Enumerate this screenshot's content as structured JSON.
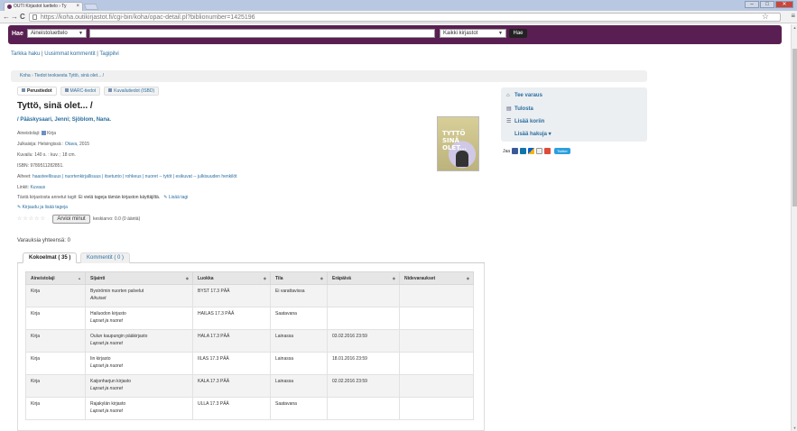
{
  "browser": {
    "tab_title": "OUTI Kirjastot luettelo › Ty",
    "url_host": "https://koha.outikirjastot.fi",
    "url_path": "/cgi-bin/koha/opac-detail.pl?biblionumber=1425196",
    "win_min": "–",
    "win_max": "□",
    "win_close": "✕",
    "back": "←",
    "forward": "→",
    "reload": "C",
    "star": "☆",
    "menu": "≡"
  },
  "search": {
    "label": "Hae",
    "type_select": "Aineistoluettelo",
    "query": "",
    "library_select": "Kaikki kirjastot",
    "button": "Hae"
  },
  "toplinks": [
    "Tarkka haku",
    "Uusimmat kommentit",
    "Tagipilvi"
  ],
  "breadcrumb": [
    "Koha",
    "Tiedot teoksesta Tyttö, sinä olet... /"
  ],
  "view_tabs": [
    "Perustiedot",
    "MARC-tiedot",
    "Kuvailutiedot (ISBD)"
  ],
  "record": {
    "title": "Tyttö, sinä olet... /",
    "authors": "/ Pääskysaari, Jenni; Sjöblom, Nana.",
    "material_label": "Aineistolaji:",
    "material_value": "Kirja",
    "publisher_label": "Julkaisija:",
    "publisher_pre": "Helsingissä :",
    "publisher_link": "Otava,",
    "publisher_year": "2015",
    "description_label": "Kuvailu:",
    "description_value": "140 s. : kuv. ; 18 cm.",
    "isbn_label": "ISBN:",
    "isbn_value": "9789511282851.",
    "subjects_label": "Aiheet:",
    "subjects_value": "haasteellisuus | nuortenkirjallisuus | itsetunto | rohkeus | nuoret -- tytöt | esikuvat -- julkisuuden henkilöt",
    "links_label": "Linkit:",
    "links_value": "Kuvaus",
    "tags_label": "Tästä kirjastosta annetut tagit:",
    "tags_value": "Ei vielä tageja tämän kirjaston käyttäjiltä.",
    "add_tag": "Lisää tagi",
    "login_tags": "Kirjaudu ja lisää tageja",
    "cover_text": "TYTTÖ SINÄ OLET...",
    "rating_stars": "☆☆☆☆☆",
    "rate_button": "Arvioi minut",
    "rating_text": "keskiarvo: 0.0 (0 ääntä)",
    "holds_total": "Varauksia yhteensä: 0"
  },
  "actions": {
    "place_hold": "Tee varaus",
    "print": "Tulosta",
    "add_cart": "Lisää koriin",
    "more_searches": "Lisää hakuja ▾",
    "share_label": "Jaa",
    "twitter": "Twitter"
  },
  "holdings_tabs": [
    "Kokoelmat ( 35 )",
    "Kommentit ( 0 )"
  ],
  "holdings": {
    "headers": [
      "Aineistolaji",
      "Sijainti",
      "Luokka",
      "Tila",
      "Eräpäivä",
      "Nidevaraukset"
    ],
    "rows": [
      {
        "type": "Kirja",
        "lib": "Byströmin nuorten palvelut",
        "shelf": "Aikuiset",
        "call": "BYST 17.3 PÄÄ",
        "status": "Ei varattavissa",
        "due": "",
        "holds": ""
      },
      {
        "type": "Kirja",
        "lib": "Hailuodon kirjasto",
        "shelf": "Lapset ja nuoret",
        "call": "HAILAS 17.3 PÄÄ",
        "status": "Saatavana",
        "due": "",
        "holds": ""
      },
      {
        "type": "Kirja",
        "lib": "Oulun kaupungin pääkirjasto",
        "shelf": "Lapset ja nuoret",
        "call": "HALA 17.3 PÄÄ",
        "status": "Lainassa",
        "due": "03.02.2016 23:59",
        "holds": ""
      },
      {
        "type": "Kirja",
        "lib": "Iin kirjasto",
        "shelf": "Lapset ja nuoret",
        "call": "IILAS 17.3 PÄÄ",
        "status": "Lainassa",
        "due": "18.01.2016 23:59",
        "holds": ""
      },
      {
        "type": "Kirja",
        "lib": "Kaijonharjun kirjasto",
        "shelf": "Lapset ja nuoret",
        "call": "KALA 17.3 PÄÄ",
        "status": "Lainassa",
        "due": "02.02.2016 23:59",
        "holds": ""
      },
      {
        "type": "Kirja",
        "lib": "Rajakylän kirjasto",
        "shelf": "Lapset ja nuoret",
        "call": "ULLA 17.3 PÄÄ",
        "status": "Saatavana",
        "due": "",
        "holds": ""
      }
    ]
  }
}
